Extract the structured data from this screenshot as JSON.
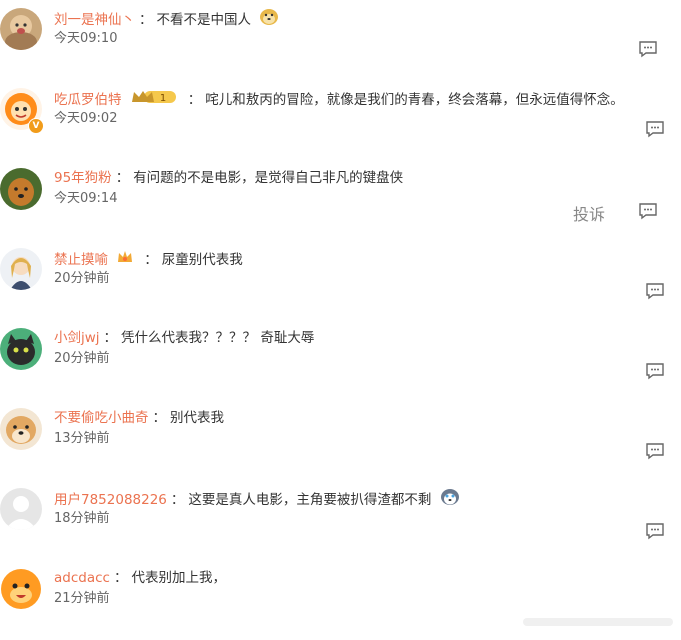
{
  "comments": [
    {
      "user": "刘一是神仙丶",
      "separator": "：",
      "text": "不看不是中国人",
      "time": "今天09:10"
    },
    {
      "user": "吃瓜罗伯特",
      "separator": "：",
      "text": "咤儿和敖丙的冒险，就像是我们的青春，终会落幕，但永远值得怀念。",
      "time": "今天09:02",
      "badge_text": "1",
      "verified_text": "V"
    },
    {
      "user": "95年狗粉",
      "separator": "：",
      "text": "有问题的不是电影，是觉得自己非凡的键盘侠",
      "time": "今天09:14",
      "report_label": "投诉"
    },
    {
      "user": "禁止摸喻",
      "separator": "：",
      "text": "尿童别代表我",
      "time": "20分钟前"
    },
    {
      "user": "小剑jwj",
      "separator": "：",
      "text": "凭什么代表我？？？？ 奇耻大辱",
      "time": "20分钟前"
    },
    {
      "user": "不要偷吃小曲奇",
      "separator": "：",
      "text": "别代表我",
      "time": "13分钟前"
    },
    {
      "user": "用户7852088226",
      "separator": "：",
      "text": "这要是真人电影，主角要被扒得渣都不剩",
      "time": "18分钟前"
    },
    {
      "user": "adcdacc",
      "separator": "：",
      "text": "代表别加上我，",
      "time": "21分钟前"
    }
  ],
  "colors": {
    "username": "#eb7350",
    "text": "#333333",
    "time": "#666666"
  }
}
